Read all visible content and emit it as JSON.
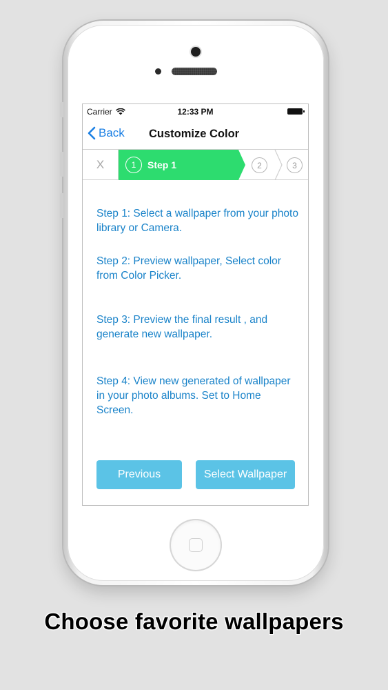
{
  "status_bar": {
    "carrier": "Carrier",
    "time": "12:33 PM"
  },
  "nav": {
    "back_label": "Back",
    "title": "Customize Color"
  },
  "steps": {
    "close_label": "X",
    "active_number": "1",
    "active_label": "Step 1",
    "step2_number": "2",
    "step3_number": "3"
  },
  "instructions": [
    {
      "text": "Step 1: Select a wallpaper from your photo library or Camera."
    },
    {
      "text": "Step 2: Preview wallpaper, Select color from Color Picker."
    },
    {
      "text": "Step 3: Preview the final result , and generate new wallpaper."
    },
    {
      "text": "Step 4: View new generated of wallpaper in your photo albums. Set to Home Screen."
    }
  ],
  "buttons": {
    "previous_label": "Previous",
    "select_label": "Select Wallpaper"
  },
  "caption": "Choose favorite wallpapers",
  "colors": {
    "accent_blue": "#1a7fe4",
    "instruction_text": "#1a83c9",
    "step_active_green": "#2ddc6f",
    "button_blue": "#5bc3e6",
    "background": "#e2e2e2"
  }
}
